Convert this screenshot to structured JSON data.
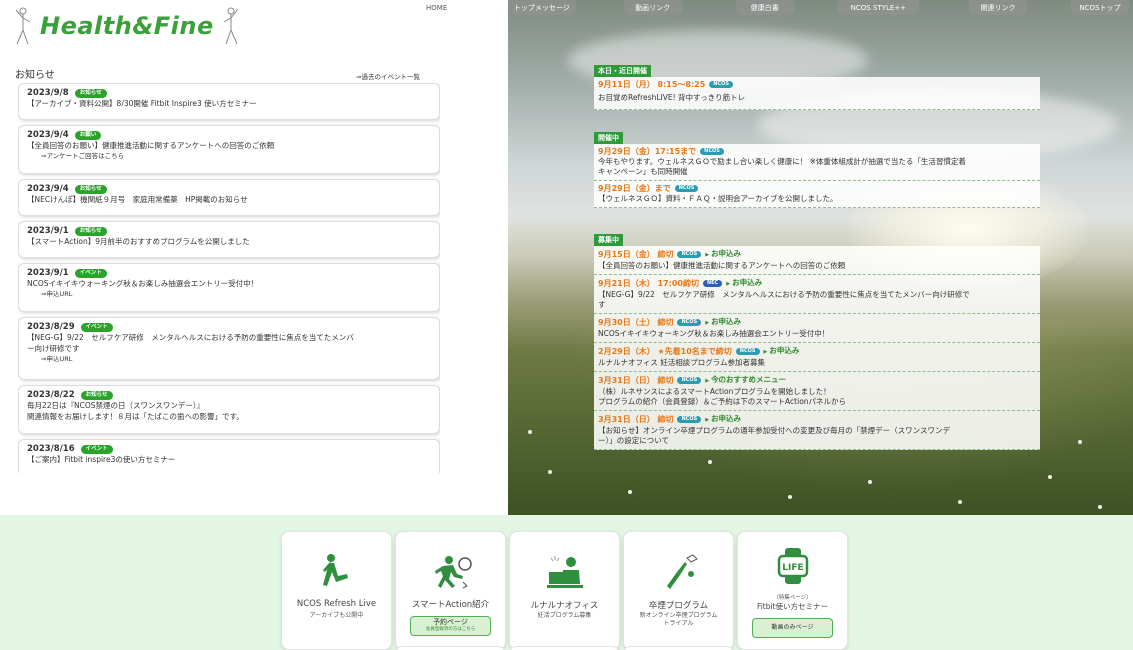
{
  "header": {
    "logo_text": "Health&Fine",
    "home_link": "HOME"
  },
  "notices": {
    "title": "お知らせ",
    "past_link": "⇒過去のイベント一覧",
    "items": [
      {
        "date": "2023/9/8",
        "badge": "お知らせ",
        "text": "【アーカイブ・資料公開】8/30開催 Fitbit Inspire3 使い方セミナー",
        "sub": ""
      },
      {
        "date": "2023/9/4",
        "badge": "お願い",
        "text": "【全員回答のお願い】健康推進活動に関するアンケートへの回答のご依頼",
        "sub": "⇒アンケートご回答はこちら"
      },
      {
        "date": "2023/9/4",
        "badge": "お知らせ",
        "text": "【NECけんぽ】機関紙９月号　家庭用常備薬　HP掲載のお知らせ",
        "sub": ""
      },
      {
        "date": "2023/9/1",
        "badge": "お知らせ",
        "text": "【スマートAction】9月前半のおすすめプログラムを公開しました",
        "sub": ""
      },
      {
        "date": "2023/9/1",
        "badge": "イベント",
        "text": "NCOSイキイキウォーキング秋＆お楽しみ抽選会エントリー受付中！",
        "sub": "⇒申込URL"
      },
      {
        "date": "2023/8/29",
        "badge": "イベント",
        "text": "【NEG-G】9/22　セルフケア研修　メンタルヘルスにおける予防の重要性に焦点を当てたメンバ",
        "text2": "ー向け研修です",
        "sub": "⇒申込URL"
      },
      {
        "date": "2023/8/22",
        "badge": "お知らせ",
        "text": "毎月22日は『NCOS禁煙の日（スワンスワンデー）』",
        "text2": "関連情報をお届けします！８月は「たばこの歯への影響」です。",
        "sub": ""
      },
      {
        "date": "2023/8/16",
        "badge": "イベント",
        "text": "【ご案内】Fitbit inspire3の使い方セミナー",
        "sub": ""
      }
    ]
  },
  "nav": {
    "items": [
      "トップメッセージ",
      "動画リンク",
      "健康白書",
      "NCOS STYLE++",
      "関連リンク",
      "NCOSトップ"
    ]
  },
  "today": {
    "label": "本日・近日開催",
    "entries": [
      {
        "head": "9月11日（月） 8:15～8:25",
        "tag": "NCOS",
        "body": "お目覚めRefreshLIVE! 背中すっきり筋トレ"
      }
    ]
  },
  "ongoing": {
    "label": "開催中",
    "entries": [
      {
        "head": "9月29日（金）17:15まで",
        "tag": "NCOS",
        "body": "今年もやります。ウェルネスＧＯで励まし合い楽しく健康に！ ※体重体組成計が抽選で当たる「生活習慣定着",
        "body2": "キャンペーン」も同時開催"
      },
      {
        "head": "9月29日（金）まで",
        "tag": "NCOS",
        "body": "【ウェルネスＧＯ】資料・ＦＡＱ・説明会アーカイブを公開しました。"
      }
    ]
  },
  "recruiting": {
    "label": "募集中",
    "entries": [
      {
        "head": "9月15日（金） 締切",
        "tag": "NCOS",
        "apply": "お申込み",
        "body": "【全員回答のお願い】健康推進活動に関するアンケートへの回答のご依頼"
      },
      {
        "head": "9月21日（木） 17:00締切",
        "tag": "NEC",
        "apply": "お申込み",
        "body": "【NEG-G】9/22　セルフケア研修　メンタルヘルスにおける予防の重要性に焦点を当てたメンバー向け研修で",
        "body2": "す"
      },
      {
        "head": "9月30日（土） 締切",
        "tag": "NCOS",
        "apply": "お申込み",
        "body": "NCOSイキイキウォーキング秋＆お楽しみ抽選会エントリー受付中！"
      },
      {
        "head": "2月29日（木） ★先着10名まで締切",
        "tag": "NCOS",
        "apply": "お申込み",
        "body": "ルナルナオフィス 妊活相談プログラム参加者募集"
      },
      {
        "head": "3月31日（日） 締切",
        "tag": "NCOS",
        "apply": "今のおすすめメニュー",
        "body": "（株）ルネサンスによるスマートActionプログラムを開始しました！",
        "body2": "プログラムの紹介（会員登録）＆ご予約は下のスマートActionパネルから"
      },
      {
        "head": "3月31日（日） 締切",
        "tag": "NCOS",
        "apply": "お申込み",
        "body": "【お知らせ】オンライン卒煙プログラムの通年参加受付への変更及び毎月の「禁煙デー（スワンスワンデ",
        "body2": "ー）」の設定について"
      }
    ]
  },
  "tiles": [
    {
      "title": "NCOS Refresh Live",
      "sub": "アーカイブも公開中",
      "icon": "stretch-person-icon"
    },
    {
      "title": "スマートAction紹介",
      "btn": "予約ページ",
      "btn_small": "会員登録済の方はこちら",
      "icon": "running-person-icon"
    },
    {
      "title": "ルナルナオフィス",
      "sub": "妊活プログラム募集",
      "icon": "computer-person-icon"
    },
    {
      "title": "卒煙プログラム",
      "sub": "新オンライン卒煙プログラム",
      "sub2": "トライアル",
      "icon": "no-smoking-icon"
    },
    {
      "title": "Fitbit使い方セミナー",
      "small": "（特集ページ）",
      "btn": "動画のみページ",
      "icon": "fitbit-life-icon",
      "icon_text": "LIFE"
    }
  ],
  "colors": {
    "green": "#29a329",
    "orange": "#e67817",
    "bottom_bg": "#e3f5e3"
  }
}
